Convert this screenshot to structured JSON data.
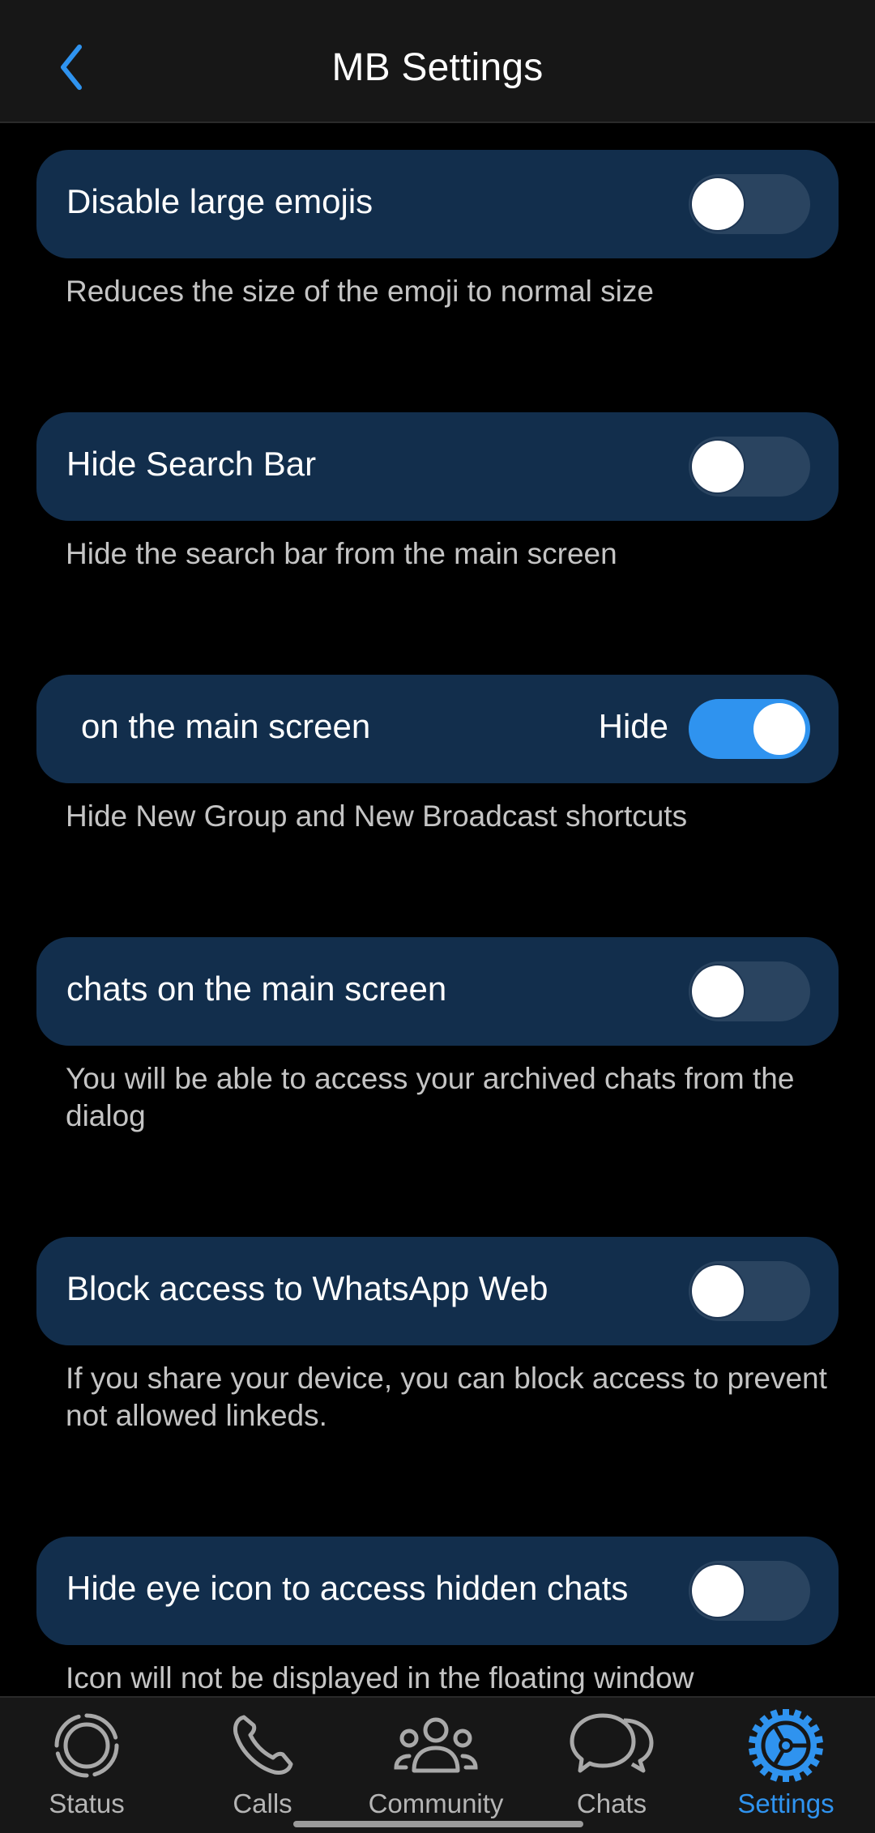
{
  "header": {
    "title": "MB Settings",
    "back_icon": "chevron-left-icon"
  },
  "colors": {
    "accent": "#2f93ef",
    "card_bg": "#122e4c",
    "header_bg": "#171717",
    "page_bg": "#000000",
    "toggle_off_track": "#2a4460"
  },
  "settings": [
    {
      "title": "Disable large emojis",
      "description": "Reduces the size of the emoji to normal size",
      "enabled": false
    },
    {
      "title": "Hide Search Bar",
      "description": "Hide the search bar from the main screen",
      "enabled": false
    },
    {
      "title": "on the main screen",
      "title_tail": "Hide",
      "description": "Hide New Group and New Broadcast shortcuts",
      "enabled": true
    },
    {
      "title": "chats on the main screen",
      "description": "You will be able to access your archived chats from the dialog",
      "enabled": false
    },
    {
      "title": "Block access to WhatsApp Web",
      "description": "If you share your device, you can block access to prevent not allowed linkeds.",
      "enabled": false
    },
    {
      "title": "Hide eye icon to access hidden chats",
      "description": "Icon will not be displayed in the floating window",
      "enabled": false
    }
  ],
  "tabbar": {
    "active": "Settings",
    "tabs": [
      {
        "label": "Status",
        "icon": "status-icon"
      },
      {
        "label": "Calls",
        "icon": "phone-icon"
      },
      {
        "label": "Community",
        "icon": "community-icon"
      },
      {
        "label": "Chats",
        "icon": "chats-icon"
      },
      {
        "label": "Settings",
        "icon": "gear-icon"
      }
    ]
  }
}
